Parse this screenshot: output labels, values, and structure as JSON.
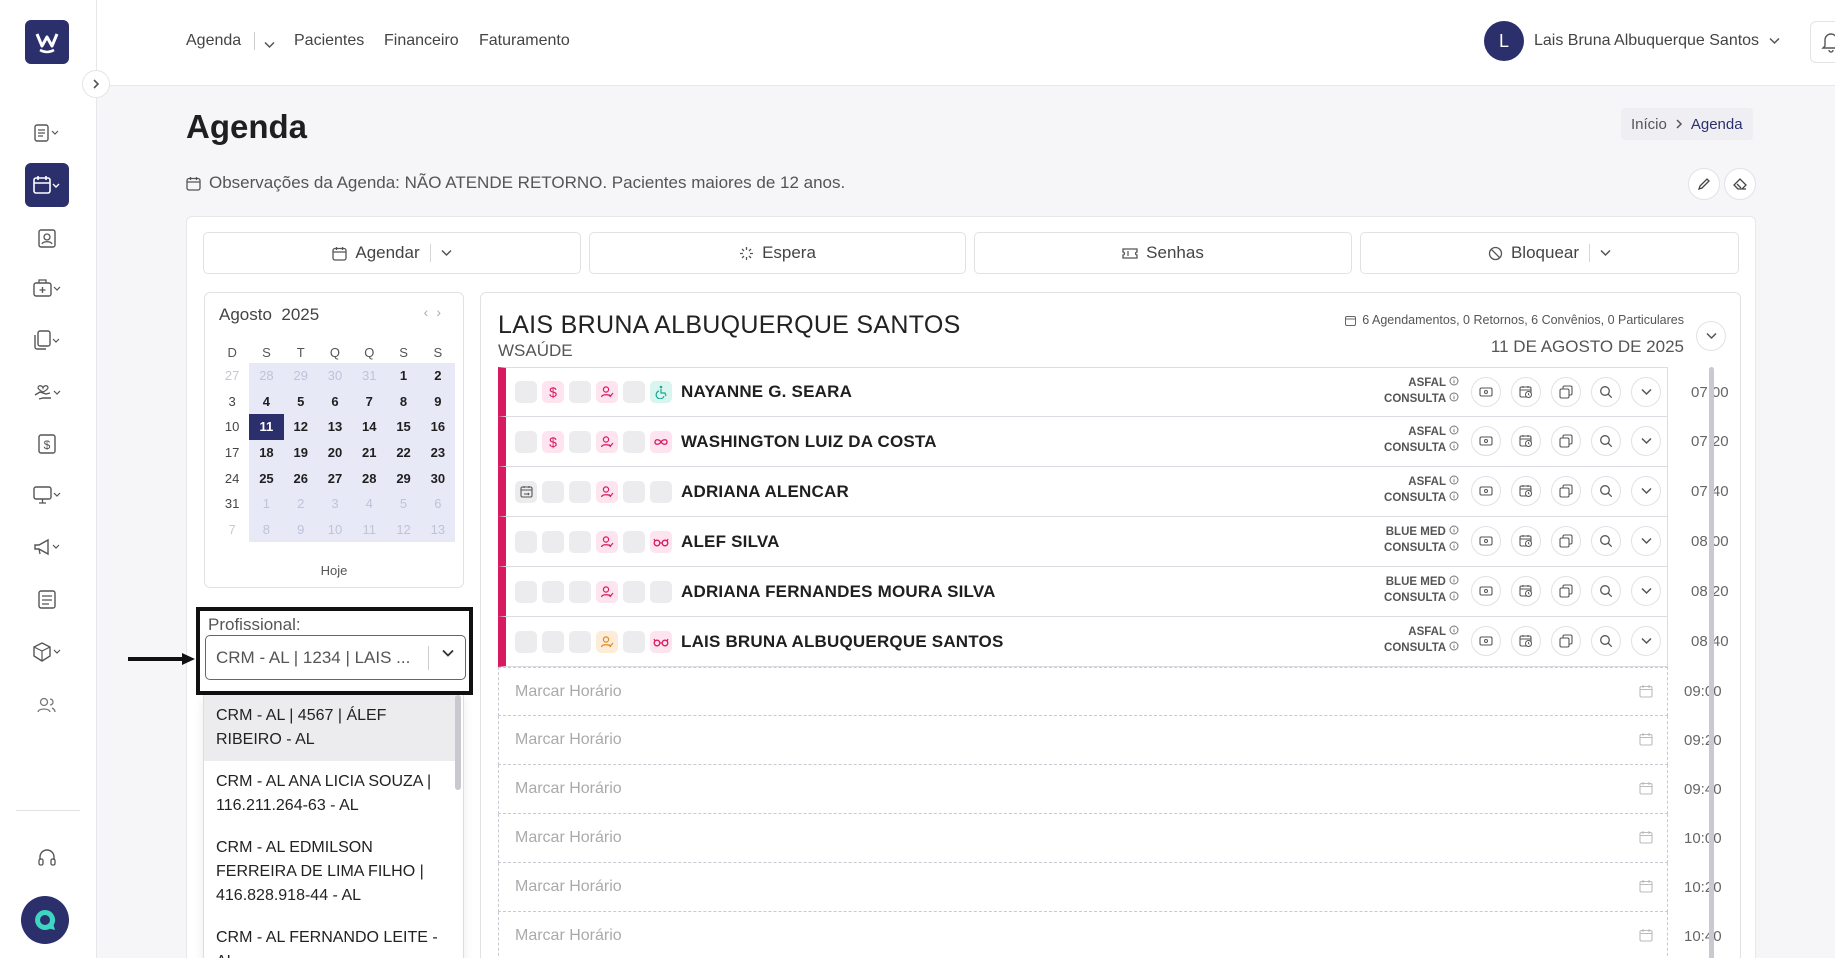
{
  "colors": {
    "brand": "#2b2f6b",
    "accent_pink": "#d81b60",
    "today_bg": "#2b2f6b",
    "weekday_bg": "#e8e9f7"
  },
  "topbar": {
    "nav": [
      "Agenda",
      "Pacientes",
      "Financeiro",
      "Faturamento"
    ],
    "user": {
      "initial": "L",
      "name": "Lais Bruna Albuquerque Santos"
    }
  },
  "page": {
    "title": "Agenda",
    "breadcrumb": {
      "home": "Início",
      "current": "Agenda"
    },
    "observations": "Observações da Agenda: NÃO ATENDE RETORNO. Pacientes maiores de 12 anos."
  },
  "toolbar": {
    "agendar": "Agendar",
    "espera": "Espera",
    "senhas": "Senhas",
    "bloquear": "Bloquear"
  },
  "calendar": {
    "month": "Agosto",
    "year": "2025",
    "weekdays": [
      "D",
      "S",
      "T",
      "Q",
      "Q",
      "S",
      "S"
    ],
    "weeks": [
      [
        "27",
        "28",
        "29",
        "30",
        "31",
        "1",
        "2"
      ],
      [
        "3",
        "4",
        "5",
        "6",
        "7",
        "8",
        "9"
      ],
      [
        "10",
        "11",
        "12",
        "13",
        "14",
        "15",
        "16"
      ],
      [
        "17",
        "18",
        "19",
        "20",
        "21",
        "22",
        "23"
      ],
      [
        "24",
        "25",
        "26",
        "27",
        "28",
        "29",
        "30"
      ],
      [
        "31",
        "1",
        "2",
        "3",
        "4",
        "5",
        "6"
      ],
      [
        "7",
        "8",
        "9",
        "10",
        "11",
        "12",
        "13"
      ]
    ],
    "selected_day": "11",
    "today_label": "Hoje"
  },
  "professional": {
    "label": "Profissional:",
    "selected": "CRM - AL | 1234 | LAIS ...",
    "options": [
      "CRM - AL | 4567 | ÁLEF RIBEIRO - AL",
      "CRM - AL ANA LICIA SOUZA | 116.211.264-63 - AL",
      "CRM - AL EDMILSON FERREIRA DE LIMA FILHO | 416.828.918-44 - AL",
      "CRM - AL FERNANDO LEITE - AL"
    ]
  },
  "schedule": {
    "doctor": "LAIS BRUNA ALBUQUERQUE SANTOS",
    "clinic": "WSAÚDE",
    "summary": "6 Agendamentos, 0 Retornos, 6 Convênios, 0 Particulares",
    "date": "11 DE AGOSTO DE 2025",
    "appointments": [
      {
        "name": "NAYANNE G. SEARA",
        "insurance": "ASFAL",
        "type": "CONSULTA",
        "time": "07:00"
      },
      {
        "name": "WASHINGTON LUIZ DA COSTA",
        "insurance": "ASFAL",
        "type": "CONSULTA",
        "time": "07:20"
      },
      {
        "name": "ADRIANA ALENCAR",
        "insurance": "ASFAL",
        "type": "CONSULTA",
        "time": "07:40"
      },
      {
        "name": "ALEF SILVA",
        "insurance": "BLUE MED",
        "type": "CONSULTA",
        "time": "08:00"
      },
      {
        "name": "ADRIANA FERNANDES MOURA SILVA",
        "insurance": "BLUE MED",
        "type": "CONSULTA",
        "time": "08:20"
      },
      {
        "name": "LAIS BRUNA ALBUQUERQUE SANTOS",
        "insurance": "ASFAL",
        "type": "CONSULTA",
        "time": "08:40"
      }
    ],
    "free_slot_label": "Marcar Horário",
    "free_slots": [
      "09:00",
      "09:20",
      "09:40",
      "10:00",
      "10:20",
      "10:40"
    ]
  }
}
